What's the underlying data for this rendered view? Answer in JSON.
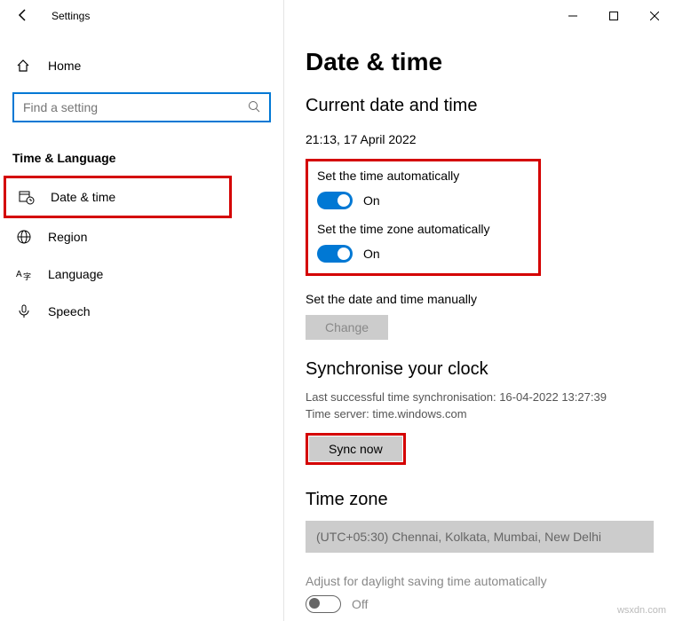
{
  "app": {
    "title": "Settings"
  },
  "window_controls": {
    "minimize": "minimize",
    "maximize": "maximize",
    "close": "close"
  },
  "sidebar": {
    "home": "Home",
    "search_placeholder": "Find a setting",
    "section": "Time & Language",
    "items": [
      {
        "label": "Date & time",
        "icon": "calendar-clock-icon"
      },
      {
        "label": "Region",
        "icon": "globe-icon"
      },
      {
        "label": "Language",
        "icon": "language-icon"
      },
      {
        "label": "Speech",
        "icon": "microphone-icon"
      }
    ]
  },
  "page": {
    "title": "Date & time",
    "subtitle": "Current date and time",
    "current": "21:13, 17 April 2022",
    "auto_time": {
      "label": "Set the time automatically",
      "state": "On"
    },
    "auto_zone": {
      "label": "Set the time zone automatically",
      "state": "On"
    },
    "manual": {
      "label": "Set the date and time manually",
      "button": "Change"
    },
    "sync": {
      "heading": "Synchronise your clock",
      "last": "Last successful time synchronisation: 16-04-2022 13:27:39",
      "server": "Time server: time.windows.com",
      "button": "Sync now"
    },
    "timezone": {
      "heading": "Time zone",
      "value": "(UTC+05:30) Chennai, Kolkata, Mumbai, New Delhi"
    },
    "dst": {
      "label": "Adjust for daylight saving time automatically",
      "state": "Off"
    }
  },
  "watermark": "wsxdn.com"
}
